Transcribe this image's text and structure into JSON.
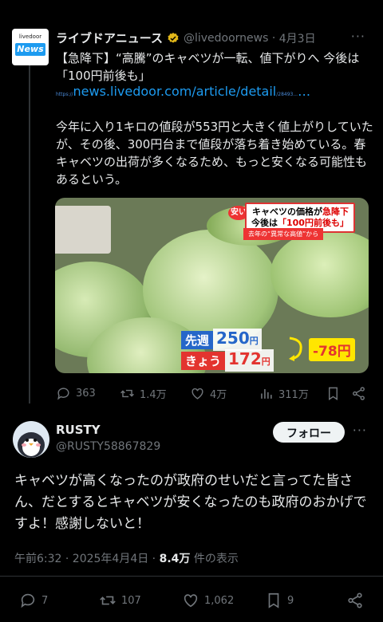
{
  "quoted": {
    "avatar": {
      "top": "livedoor",
      "bottom": "News"
    },
    "name": "ライブドアニュース",
    "handle": "@livedoornews",
    "date": "4月3日",
    "headline": "【急降下】“高騰”のキャベツが一転、値下がりへ 今後は「100円前後も」",
    "link": "news.livedoor.com/article/detail",
    "link_prefix": "https://",
    "link_suffix": "/28493...",
    "body": "今年に入り1キロの値段が553円と大きく値上がりしていたが、その後、300円台まで値段が落ち着き始めている。春キャベツの出荷が多くなるため、もっと安くなる可能性もあるという。",
    "media": {
      "badge": "安い",
      "title_line1_a": "キャベツの価格が",
      "title_line1_b": "急降下",
      "title_line2_a": "今後は",
      "title_line2_b": "「100円前後も」",
      "subtitle": "去年の“異常な高値”から",
      "prev_label": "先週",
      "prev_value": "250",
      "today_label": "きょう",
      "today_value": "172",
      "yen": "円",
      "diff": "-78円"
    },
    "stats": {
      "replies": "363",
      "retweets": "1.4万",
      "likes": "4万",
      "views": "311万"
    }
  },
  "reply": {
    "name": "RUSTY",
    "handle": "@RUSTY58867829",
    "follow_label": "フォロー",
    "text": "キャベツが高くなったのが政府のせいだと言ってた皆さん、だとするとキャベツが安くなったのも政府のおかげですよ！感謝しないと！",
    "time": "午前6:32 · 2025年4月4日 · ",
    "views": "8.4万",
    "views_suffix": " 件の表示",
    "stats": {
      "replies": "7",
      "retweets": "107",
      "likes": "1,062",
      "bookmarks": "9"
    }
  },
  "colors": {
    "accent": "#1d9bf0",
    "bg": "#000000",
    "muted": "#71767b"
  }
}
